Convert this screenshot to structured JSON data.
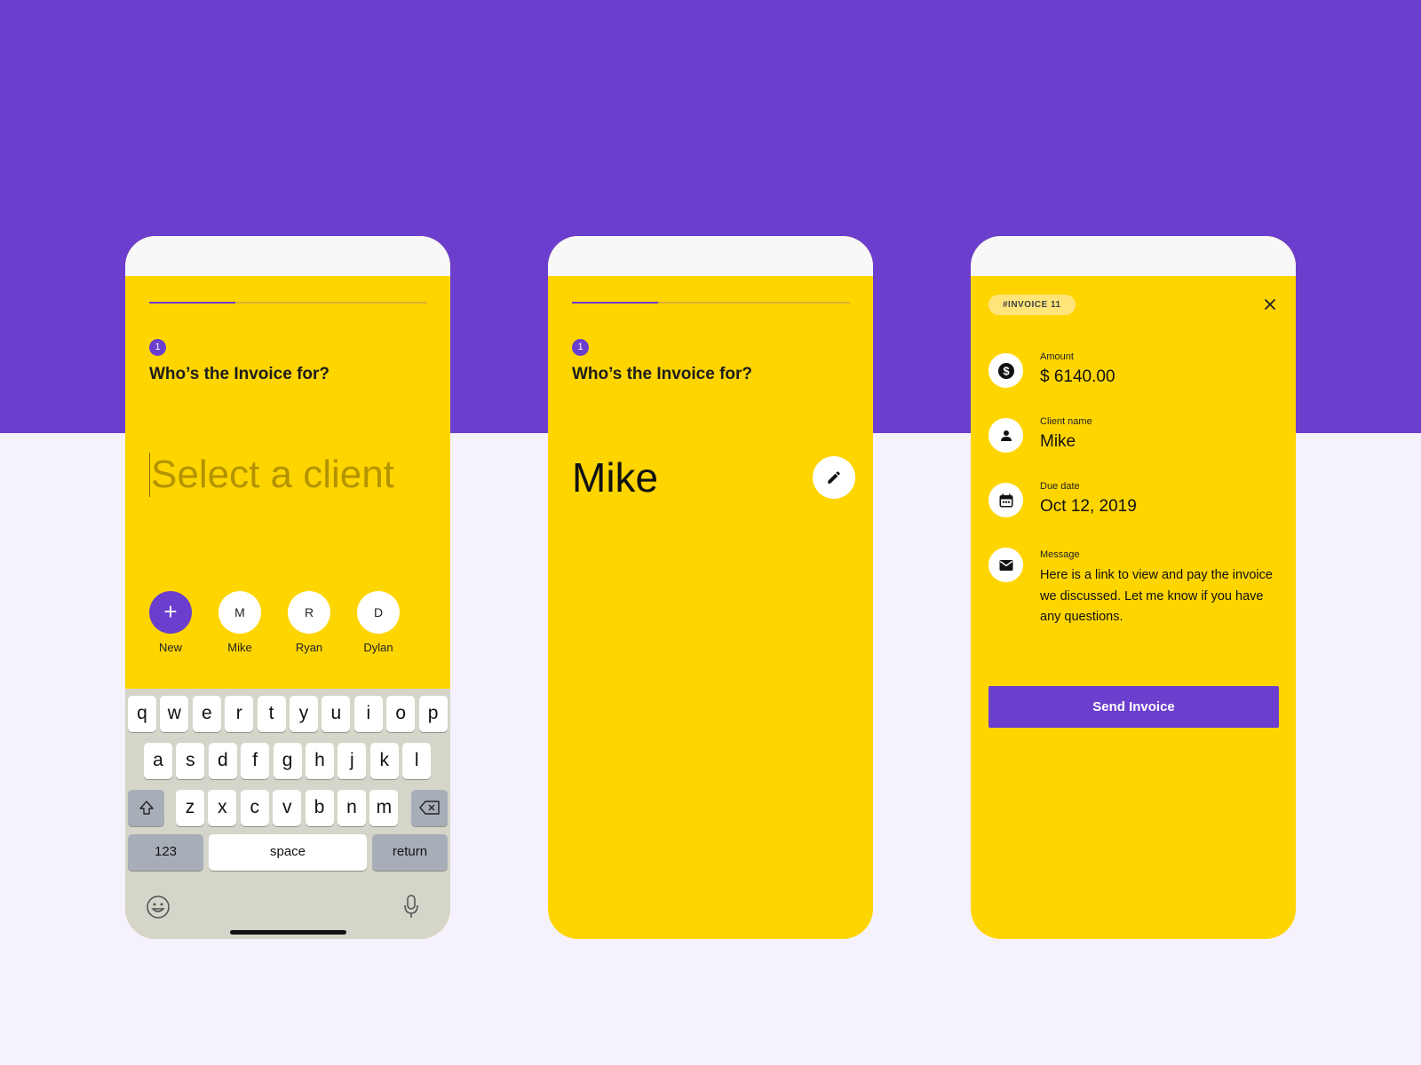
{
  "screen1": {
    "progress": 0.31,
    "step": "1",
    "question": "Who’s the Invoice for?",
    "input_placeholder": "Select a client",
    "clients": [
      {
        "initial": "+",
        "label": "New"
      },
      {
        "initial": "M",
        "label": "Mike"
      },
      {
        "initial": "R",
        "label": "Ryan"
      },
      {
        "initial": "D",
        "label": "Dylan"
      }
    ],
    "keyboard": {
      "row1": [
        "q",
        "w",
        "e",
        "r",
        "t",
        "y",
        "u",
        "i",
        "o",
        "p"
      ],
      "row2": [
        "a",
        "s",
        "d",
        "f",
        "g",
        "h",
        "j",
        "k",
        "l"
      ],
      "row3": [
        "z",
        "x",
        "c",
        "v",
        "b",
        "n",
        "m"
      ],
      "numbers_label": "123",
      "space_label": "space",
      "return_label": "return"
    }
  },
  "screen2": {
    "progress": 0.31,
    "step": "1",
    "question": "Who’s the Invoice for?",
    "client_name": "Mike"
  },
  "screen3": {
    "invoice_badge": "#INVOICE 11",
    "amount_label": "Amount",
    "amount_value": "$ 6140.00",
    "client_label": "Client name",
    "client_value": "Mike",
    "due_label": "Due date",
    "due_value": "Oct 12, 2019",
    "message_label": "Message",
    "message_value": "Here is a link to view and pay the invoice we discussed. Let me know if you have any questions.",
    "send_label": "Send Invoice"
  },
  "colors": {
    "accent": "#6b3ecd",
    "card": "#ffd500",
    "background": "#f5f2fd"
  }
}
